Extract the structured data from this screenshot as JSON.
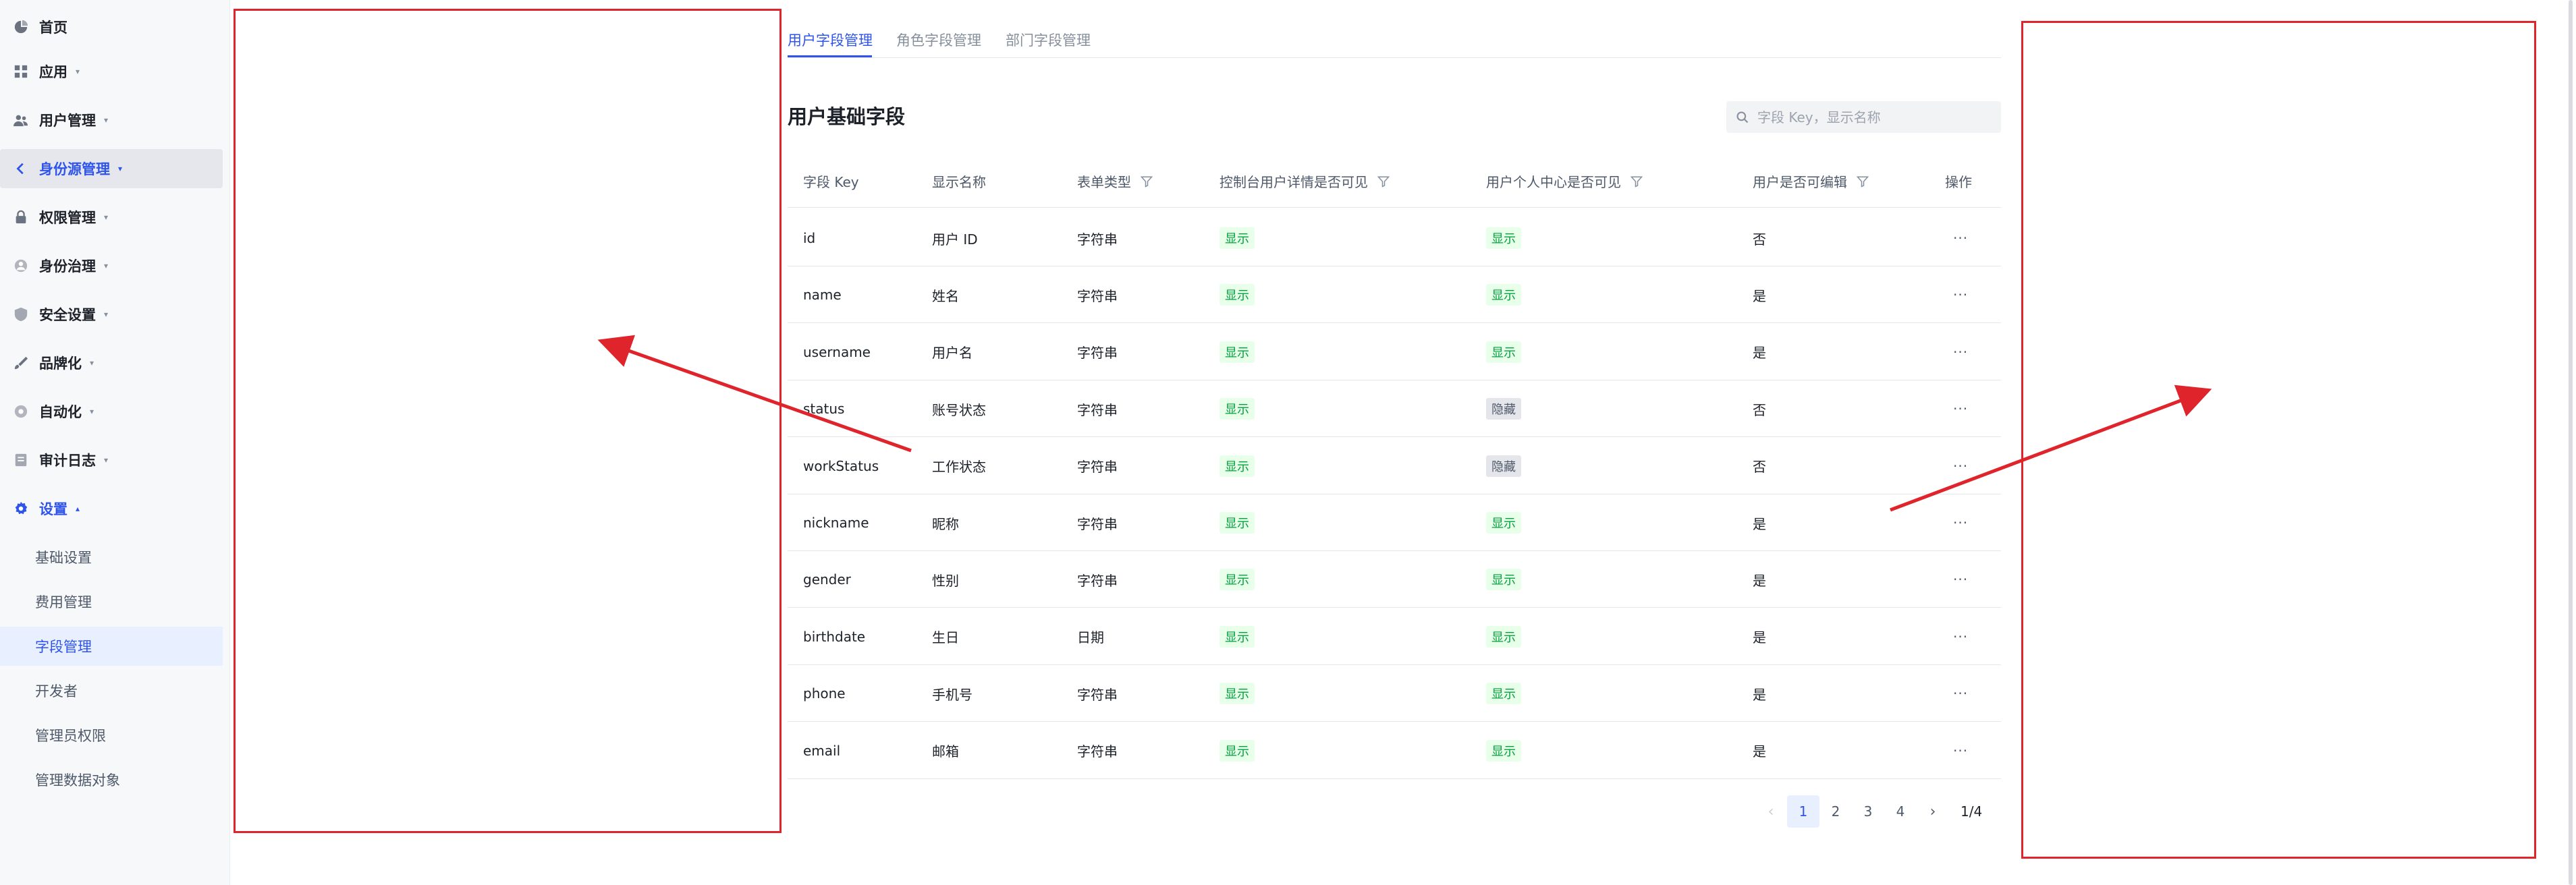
{
  "sidebar": {
    "items": [
      {
        "label": "首页",
        "icon": "dashboard-icon",
        "caret": ""
      },
      {
        "label": "应用",
        "icon": "apps-icon",
        "caret": "▾"
      },
      {
        "label": "用户管理",
        "icon": "users-icon",
        "caret": "▾"
      },
      {
        "label": "身份源管理",
        "icon": "identity-source-icon",
        "caret": "▾"
      },
      {
        "label": "权限管理",
        "icon": "lock-icon",
        "caret": "▾"
      },
      {
        "label": "身份治理",
        "icon": "governance-icon",
        "caret": "▾"
      },
      {
        "label": "安全设置",
        "icon": "shield-icon",
        "caret": "▾"
      },
      {
        "label": "品牌化",
        "icon": "brush-icon",
        "caret": "▾"
      },
      {
        "label": "自动化",
        "icon": "automation-icon",
        "caret": "▾"
      },
      {
        "label": "审计日志",
        "icon": "audit-log-icon",
        "caret": "▾"
      },
      {
        "label": "设置",
        "icon": "gear-icon",
        "caret": "▴"
      }
    ],
    "settings_sub": [
      "基础设置",
      "费用管理",
      "字段管理",
      "开发者",
      "管理员权限",
      "管理数据对象"
    ]
  },
  "tabs": [
    "用户字段管理",
    "角色字段管理",
    "部门字段管理"
  ],
  "section_title": "用户基础字段",
  "search": {
    "placeholder": "字段 Key，显示名称"
  },
  "table": {
    "headers": [
      "字段 Key",
      "显示名称",
      "表单类型",
      "控制台用户详情是否可见",
      "用户个人中心是否可见",
      "用户是否可编辑",
      "操作"
    ],
    "rows": [
      {
        "key": "id",
        "name": "用户 ID",
        "type": "字符串",
        "console": "显示",
        "personal": "显示",
        "editable": "否",
        "action": "···"
      },
      {
        "key": "name",
        "name": "姓名",
        "type": "字符串",
        "console": "显示",
        "personal": "显示",
        "editable": "是",
        "action": "···"
      },
      {
        "key": "username",
        "name": "用户名",
        "type": "字符串",
        "console": "显示",
        "personal": "显示",
        "editable": "是",
        "action": "···"
      },
      {
        "key": "status",
        "name": "账号状态",
        "type": "字符串",
        "console": "显示",
        "personal": "隐藏",
        "editable": "否",
        "action": "···"
      },
      {
        "key": "workStatus",
        "name": "工作状态",
        "type": "字符串",
        "console": "显示",
        "personal": "隐藏",
        "editable": "否",
        "action": "···"
      },
      {
        "key": "nickname",
        "name": "昵称",
        "type": "字符串",
        "console": "显示",
        "personal": "显示",
        "editable": "是",
        "action": "···"
      },
      {
        "key": "gender",
        "name": "性别",
        "type": "字符串",
        "console": "显示",
        "personal": "显示",
        "editable": "是",
        "action": "···"
      },
      {
        "key": "birthdate",
        "name": "生日",
        "type": "日期",
        "console": "显示",
        "personal": "显示",
        "editable": "是",
        "action": "···"
      },
      {
        "key": "phone",
        "name": "手机号",
        "type": "字符串",
        "console": "显示",
        "personal": "显示",
        "editable": "是",
        "action": "···"
      },
      {
        "key": "email",
        "name": "邮箱",
        "type": "字符串",
        "console": "显示",
        "personal": "显示",
        "editable": "是",
        "action": "···"
      }
    ]
  },
  "pagination": {
    "prev": "‹",
    "pages": [
      "1",
      "2",
      "3",
      "4"
    ],
    "next": "›",
    "info": "1/4"
  },
  "colors": {
    "accent": "#2f54eb",
    "annotation": "#e0242b",
    "tag_show": "#00a23c"
  }
}
